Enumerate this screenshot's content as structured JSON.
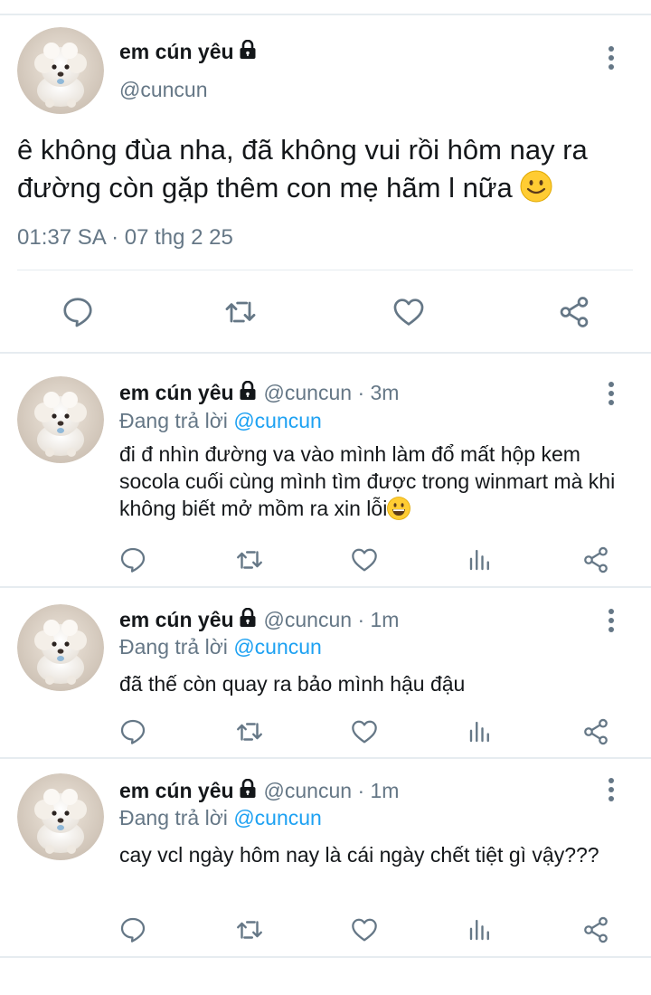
{
  "main_tweet": {
    "display_name": "em cún yêu",
    "handle": "@cuncun",
    "text": "ê không đùa nha, đã không vui rồi hôm nay ra đường còn gặp thêm con mẹ hãm l nữa",
    "timestamp": "01:37 SA · 07 thg 2 25",
    "actions": [
      "reply-icon",
      "retweet-icon",
      "like-icon",
      "share-icon"
    ]
  },
  "replies": [
    {
      "display_name": "em cún yêu",
      "handle_time": "@cuncun · 3m",
      "replying_prefix": "Đang trả lời",
      "replying_to": "@cuncun",
      "text": "đi đ nhìn đường va vào mình làm đổ mất hộp kem socola cuối cùng mình tìm được trong winmart mà khi không biết mở mồm ra xin lỗi"
    },
    {
      "display_name": "em cún yêu",
      "handle_time": "@cuncun · 1m",
      "replying_prefix": "Đang trả lời",
      "replying_to": "@cuncun",
      "text": "đã thế còn quay ra bảo mình hậu đậu"
    },
    {
      "display_name": "em cún yêu",
      "handle_time": "@cuncun · 1m",
      "replying_prefix": "Đang trả lời",
      "replying_to": "@cuncun",
      "text": "cay vcl ngày hôm nay là cái ngày chết tiệt gì vậy???"
    }
  ],
  "colors": {
    "text": "#14171a",
    "secondary": "#657786",
    "accent": "#1da1f2",
    "divider": "#e6ecf0",
    "icon": "#657786"
  }
}
